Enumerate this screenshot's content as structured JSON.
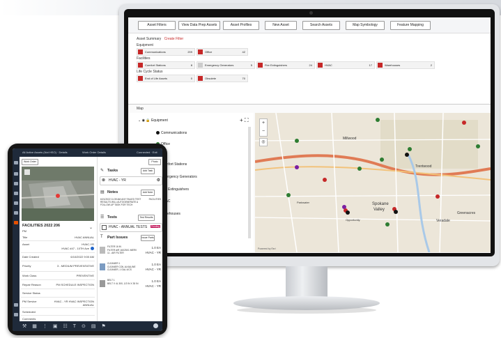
{
  "desktop": {
    "toolbar": [
      "Asset Filters",
      "View Data Prep Assets",
      "Asset Profiles",
      "New Asset",
      "Search Assets",
      "Map Symbology",
      "Feature Mapping"
    ],
    "tab_summary": "Asset Summary",
    "tab_filter": "Create Filter",
    "equipment_title": "Equipment",
    "facilities_title": "Facilities",
    "lifecycle_title": "Life Cycle Status",
    "equipment_cards": [
      {
        "label": "Communications",
        "count": "209"
      },
      {
        "label": "Office",
        "count": "42"
      }
    ],
    "facility_cards": [
      {
        "label": "Comfort Stations",
        "count": "8"
      },
      {
        "label": "Emergency Generators",
        "count": "5"
      },
      {
        "label": "Fire Extinguishers",
        "count": "24"
      },
      {
        "label": "HVAC",
        "count": "17"
      },
      {
        "label": "Warehouses",
        "count": "2"
      }
    ],
    "lifecycle_cards": [
      {
        "label": "End of Life Assets",
        "count": "0"
      },
      {
        "label": "Obsolete",
        "count": "70"
      }
    ],
    "map_title": "Map",
    "legend": {
      "equipment": "Equipment",
      "communications": "Communications",
      "office": "Office",
      "comfort": "Comfort Stations",
      "generators": "Emergency Generators",
      "extinguishers": "Fire Extinguishers",
      "hvac": "HVAC",
      "warehouses": "Warehouses"
    },
    "map_labels": {
      "millwood": "Millwood",
      "spokane": "Spokane",
      "valley": "Valley",
      "trentwood": "Trentwood",
      "greenacres": "Greenacres",
      "veradale": "Veradale",
      "opportunity": "Opportunity",
      "parkwater": "Parkwater",
      "credit": "Powered by Esri"
    },
    "colors": {
      "accent": "#c62828",
      "green": "#2e7d32",
      "purple": "#7b1fa2",
      "black": "#111111",
      "blue": "#1e63c8"
    }
  },
  "tablet": {
    "status_left": "All Active Assets (Not HSO) · Details",
    "status_mid": "Work Order Details",
    "status_right": "Connected · Exit",
    "top_left_btn": "Work Order",
    "top_right_btn": "Photo",
    "facility_title": "FACILITIES 2022 206",
    "facility_sub": "PM",
    "fields": [
      {
        "label": "Title",
        "value": "HVAC ANNUAL"
      },
      {
        "label": "Asset",
        "value": "HVAC-YR"
      },
      {
        "label": "",
        "value": "HVAC #47 - 10TH Ave"
      },
      {
        "label": "Date Created",
        "value": "6/10/2022 9:00 AM"
      },
      {
        "label": "Priority",
        "value": "3 - MEDIUM PREVENTATIVE"
      },
      {
        "label": "Work Class",
        "value": "PREVENTIVE"
      },
      {
        "label": "Repair Reason",
        "value": "PM SCHEDULE INSPECTION"
      },
      {
        "label": "Service Status",
        "value": ""
      },
      {
        "label": "PM Service",
        "value": "HVAC - YR  HVAC INSPECTION ANNUAL"
      },
      {
        "label": "Scheduled",
        "value": ""
      },
      {
        "label": "Comments",
        "value": ""
      }
    ],
    "tasks_title": "Tasks",
    "tasks_btn": "Add Task",
    "task_item": "HVAC - YR",
    "notes_title": "Notes",
    "notes_btn": "Add Note",
    "note_text": "6/21/2022 11:39 AM ANY FAILED TEST RESULTS WILL AUTOGENERATE A FOLLOW-UP TASK FOR TECH",
    "note_user": "FACILITIES",
    "tests_title": "Tests",
    "tests_btn": "Test Results",
    "test_item": "HVAC - ANNUAL TESTS",
    "test_badge": "Pending",
    "parts_title": "Part Issues",
    "parts_btn": "Issue Parts",
    "parts": [
      {
        "name": "FILTER 16 IN",
        "desc": "FILTER AIR 16X25X1 MERV 11 - AIR FILTER",
        "qty": "1.0 EA",
        "code": "HVAC - YR"
      },
      {
        "name": "CLEANER 1",
        "desc": "CLEANER COIL ALKALINE CLEANER, 1 GAL 4/CS",
        "qty": "1.0 EA",
        "code": "HVAC - YR"
      },
      {
        "name": "BELT 1",
        "desc": "BELT V 4L 300, 1/2 IN X 30 IN",
        "qty": "1.0 EA",
        "code": "HVAC - YR"
      }
    ]
  }
}
